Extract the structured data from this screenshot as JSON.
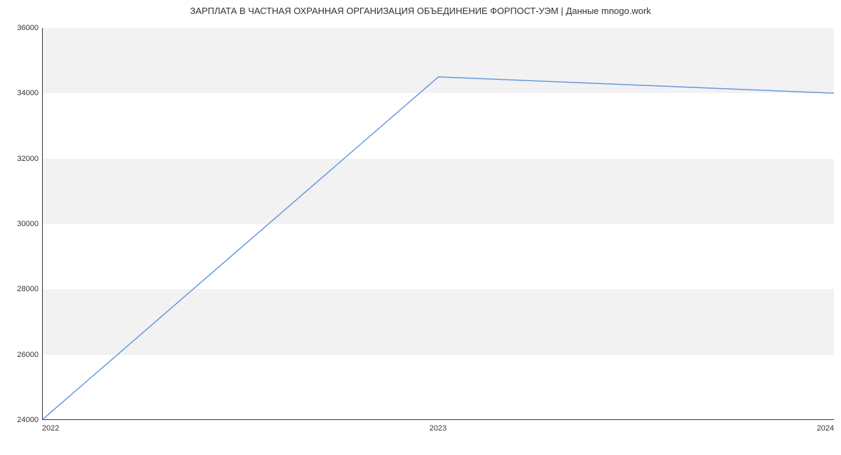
{
  "chart_data": {
    "type": "line",
    "title": "ЗАРПЛАТА В  ЧАСТНАЯ ОХРАННАЯ ОРГАНИЗАЦИЯ ОБЪЕДИНЕНИЕ ФОРПОСТ-УЭМ | Данные mnogo.work",
    "x": [
      "2022",
      "2023",
      "2024"
    ],
    "values": [
      24000,
      34500,
      34000
    ],
    "xlabel": "",
    "ylabel": "",
    "ylim": [
      24000,
      36000
    ],
    "y_ticks": [
      24000,
      26000,
      28000,
      30000,
      32000,
      34000,
      36000
    ],
    "x_ticks": [
      "2022",
      "2023",
      "2024"
    ],
    "line_color": "#6699dd",
    "band_color": "#f2f2f2"
  }
}
